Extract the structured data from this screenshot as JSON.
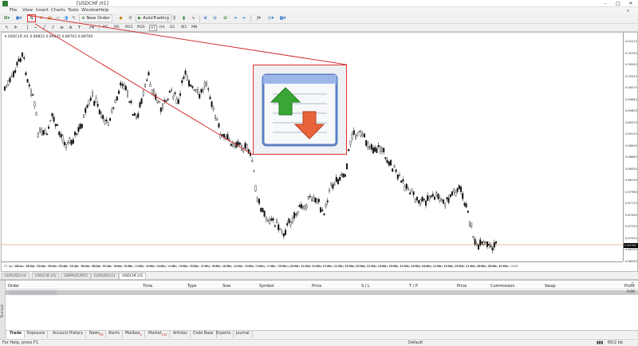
{
  "window": {
    "title": "[USDCHF,H1]",
    "controls": [
      "–",
      "□",
      "✕"
    ]
  },
  "menu": [
    "File",
    "View",
    "Insert",
    "Charts",
    "Tools",
    "Window",
    "Help"
  ],
  "toolbar": {
    "new_order": "New Order",
    "autotrading": "AutoTrading"
  },
  "timeframes": [
    "M1",
    "M5",
    "M15",
    "M30",
    "H1",
    "H4",
    "D1",
    "W1",
    "MN"
  ],
  "chart": {
    "header": "USDCHF,H1  0.89822 0.89835 0.89763 0.89760",
    "price_label": "0.89760",
    "price_ticks": [
      "0.91015",
      "0.90780",
      "0.90545",
      "0.90310",
      "0.90075",
      "0.89840",
      "0.89605",
      "0.89370",
      "0.89135",
      "0.88900",
      "0.88665",
      "0.88430",
      "0.88195",
      "0.87960",
      "0.87725",
      "0.87490",
      "0.87255",
      "0.87020",
      "0.86785",
      "0.86550"
    ],
    "time_ticks": [
      "27 Apr 2021",
      "28 Apr 03:00",
      "28 Apr 11:00",
      "28 Apr 19:00",
      "29 Apr 03:00",
      "29 Apr 11:00",
      "29 Apr 19:00",
      "30 Apr 03:00",
      "30 Apr 11:00",
      "30 Apr 19:00",
      "3 May 03:00",
      "3 May 11:00",
      "3 May 19:00",
      "4 May 03:00",
      "4 May 11:00",
      "4 May 19:00",
      "5 May 03:00",
      "5 May 11:00",
      "5 May 19:00",
      "6 May 03:00",
      "6 May 11:00",
      "6 May 19:00",
      "7 May 03:00",
      "7 May 11:00",
      "7 May 19:00",
      "10 May 03:00",
      "10 May 11:00",
      "10 May 19:00",
      "11 May 03:00",
      "11 May 11:00",
      "11 May 19:00",
      "12 May 03:00",
      "12 May 11:00",
      "12 May 19:00",
      "13 May 03:00",
      "13 May 11:00",
      "13 May 19:00",
      "14 May 03:00",
      "14 May 11:00",
      "14 May 19:00",
      "17 May 03:00",
      "17 May 11:00",
      "17 May 19:00",
      "18 May 03:00",
      "18 May 11:00",
      "18 May 19:00"
    ]
  },
  "symbol_tabs": [
    "EURUSD,H4",
    "USDCHF,H1",
    "GBPAUD,M15",
    "EURUSD,H1",
    "USDCHF,H1"
  ],
  "terminal": {
    "side_label": "Terminal",
    "columns": [
      "Order",
      "Time",
      "Type",
      "Size",
      "Symbol",
      "Price",
      "S / L",
      "T / P",
      "Price",
      "Commission",
      "Swap",
      "Profit"
    ],
    "profit": "0.00",
    "tabs": [
      {
        "label": "Trade",
        "count": ""
      },
      {
        "label": "Exposure",
        "count": ""
      },
      {
        "label": "Account History",
        "count": ""
      },
      {
        "label": "News",
        "count": "99"
      },
      {
        "label": "Alerts",
        "count": ""
      },
      {
        "label": "Mailbox",
        "count": "4"
      },
      {
        "label": "Market",
        "count": "134"
      },
      {
        "label": "Articles",
        "count": ""
      },
      {
        "label": "Code Base",
        "count": ""
      },
      {
        "label": "Experts",
        "count": ""
      },
      {
        "label": "Journal",
        "count": ""
      }
    ]
  },
  "status": {
    "help": "For Help, press F1",
    "profile": "Default",
    "traffic": "65/2 kb"
  },
  "colors": {
    "accent_red": "#d33333",
    "up_arrow": "#3aa635",
    "down_arrow": "#e8623a",
    "candle": "#111111"
  }
}
